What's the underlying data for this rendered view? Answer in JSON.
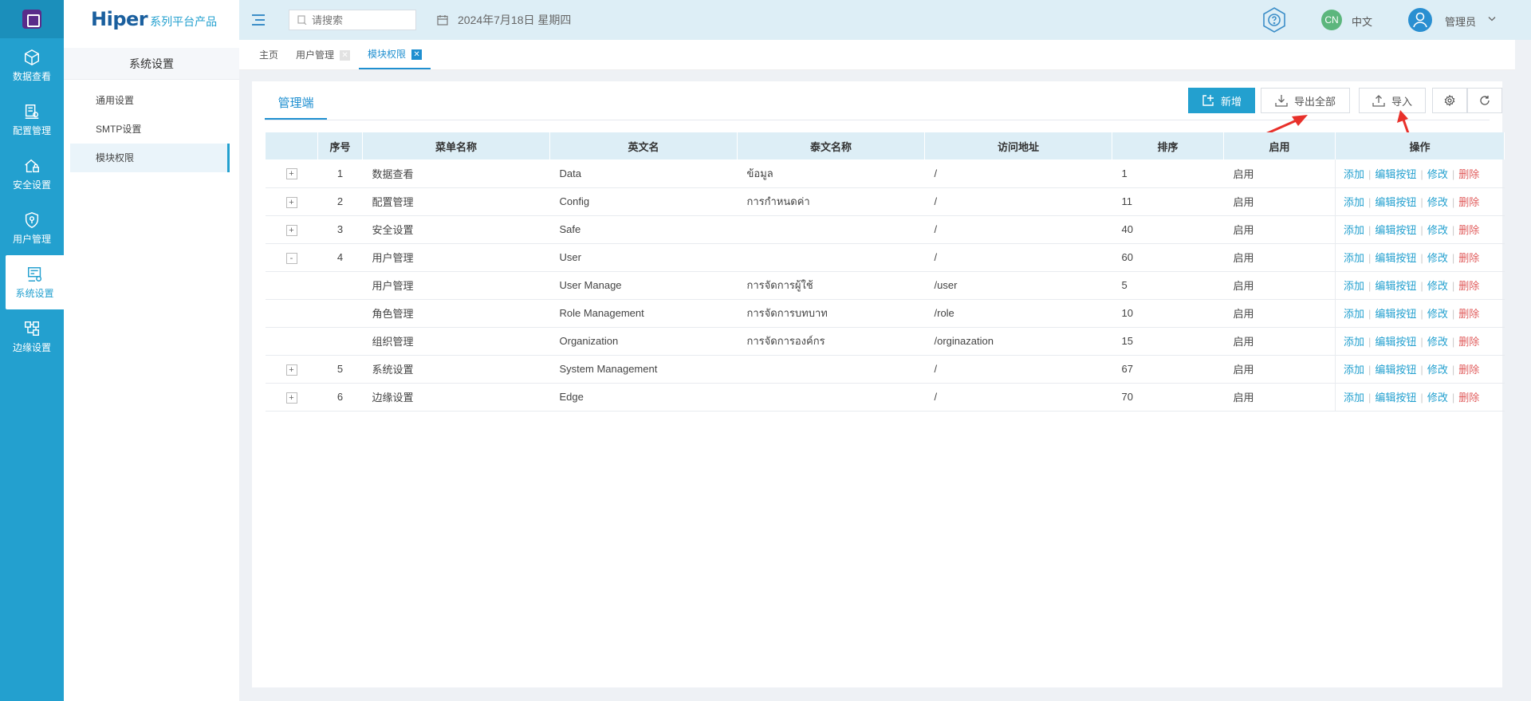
{
  "rail": {
    "items": [
      {
        "label": "数据查看",
        "icon": "cube-icon"
      },
      {
        "label": "配置管理",
        "icon": "config-icon"
      },
      {
        "label": "安全设置",
        "icon": "lock-home-icon"
      },
      {
        "label": "用户管理",
        "icon": "user-shield-icon"
      },
      {
        "label": "系统设置",
        "icon": "system-settings-icon",
        "active": true
      },
      {
        "label": "边缘设置",
        "icon": "edge-nodes-icon"
      }
    ]
  },
  "brand": {
    "main": "Hiper",
    "sub": "系列平台产品"
  },
  "sidebar": {
    "title": "系统设置",
    "items": [
      {
        "label": "通用设置"
      },
      {
        "label": "SMTP设置"
      },
      {
        "label": "模块权限",
        "active": true
      }
    ]
  },
  "header": {
    "search_placeholder": "请搜索",
    "date": "2024年7月18日 星期四",
    "lang_badge": "CN",
    "lang_label": "中文",
    "user_name": "管理员"
  },
  "tabs": [
    {
      "label": "主页",
      "closable": false
    },
    {
      "label": "用户管理",
      "closable": true
    },
    {
      "label": "模块权限",
      "closable": true,
      "active": true
    }
  ],
  "panel": {
    "tab": "管理端",
    "buttons": {
      "add": "新增",
      "export_all": "导出全部",
      "import": "导入"
    }
  },
  "table": {
    "headers": [
      "",
      "序号",
      "菜单名称",
      "英文名",
      "泰文名称",
      "访问地址",
      "排序",
      "启用",
      "操作"
    ],
    "actions": {
      "add": "添加",
      "edit_button": "编辑按钮",
      "modify": "修改",
      "delete": "删除"
    },
    "rows": [
      {
        "expand": "+",
        "index": "1",
        "name": "数据查看",
        "en": "Data",
        "th": "ข้อมูล",
        "url": "/",
        "order": "1",
        "enabled": "启用"
      },
      {
        "expand": "+",
        "index": "2",
        "name": "配置管理",
        "en": "Config",
        "th": "การกำหนดค่า",
        "url": "/",
        "order": "11",
        "enabled": "启用"
      },
      {
        "expand": "+",
        "index": "3",
        "name": "安全设置",
        "en": "Safe",
        "th": "",
        "url": "/",
        "order": "40",
        "enabled": "启用"
      },
      {
        "expand": "-",
        "index": "4",
        "name": "用户管理",
        "en": "User",
        "th": "",
        "url": "/",
        "order": "60",
        "enabled": "启用"
      },
      {
        "expand": "",
        "index": "",
        "name": "用户管理",
        "en": "User Manage",
        "th": "การจัดการผู้ใช้",
        "url": "/user",
        "order": "5",
        "enabled": "启用"
      },
      {
        "expand": "",
        "index": "",
        "name": "角色管理",
        "en": "Role Management",
        "th": "การจัดการบทบาท",
        "url": "/role",
        "order": "10",
        "enabled": "启用"
      },
      {
        "expand": "",
        "index": "",
        "name": "组织管理",
        "en": "Organization",
        "th": "การจัดการองค์กร",
        "url": "/orginazation",
        "order": "15",
        "enabled": "启用"
      },
      {
        "expand": "+",
        "index": "5",
        "name": "系统设置",
        "en": "System Management",
        "th": "",
        "url": "/",
        "order": "67",
        "enabled": "启用"
      },
      {
        "expand": "+",
        "index": "6",
        "name": "边缘设置",
        "en": "Edge",
        "th": "",
        "url": "/",
        "order": "70",
        "enabled": "启用"
      }
    ]
  },
  "colors": {
    "primary": "#23a0cf",
    "header_bg": "#ddeef6",
    "danger": "#e05b5b",
    "arrow": "#e8302a"
  }
}
